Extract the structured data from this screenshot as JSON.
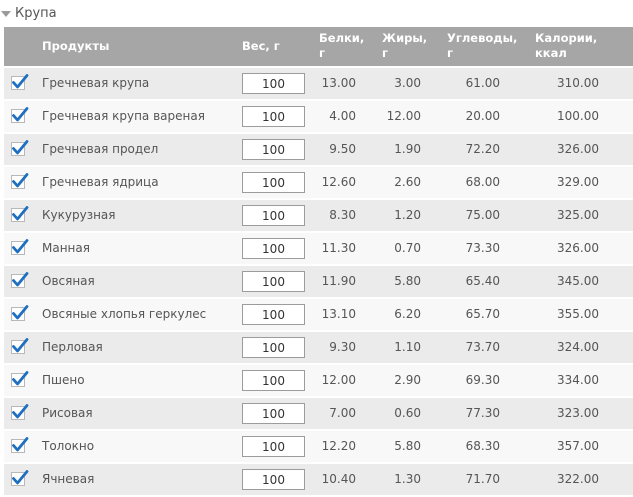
{
  "section": {
    "title": "Крупа",
    "icon": "collapse-triangle-icon"
  },
  "columns": {
    "product": "Продукты",
    "weight": "Вес, г",
    "protein_line1": "Белки,",
    "protein_line2": "г",
    "fat_line1": "Жиры,",
    "fat_line2": "г",
    "carbs_line1": "Углеводы,",
    "carbs_line2": "г",
    "calories_line1": "Калории,",
    "calories_line2": "ккал"
  },
  "colors": {
    "header_bg": "#a6a6a6",
    "row_odd": "#ebebeb",
    "row_even": "#f8f8f8",
    "checkmark": "#1e6fc0"
  },
  "rows": [
    {
      "name": "Гречневая крупа",
      "checked": true,
      "weight": "100",
      "protein": "13.00",
      "fat": "3.00",
      "carbs": "61.00",
      "calories": "310.00"
    },
    {
      "name": "Гречневая крупа вареная",
      "checked": true,
      "weight": "100",
      "protein": "4.00",
      "fat": "12.00",
      "carbs": "20.00",
      "calories": "100.00"
    },
    {
      "name": "Гречневая продел",
      "checked": true,
      "weight": "100",
      "protein": "9.50",
      "fat": "1.90",
      "carbs": "72.20",
      "calories": "326.00"
    },
    {
      "name": "Гречневая ядрица",
      "checked": true,
      "weight": "100",
      "protein": "12.60",
      "fat": "2.60",
      "carbs": "68.00",
      "calories": "329.00"
    },
    {
      "name": "Кукурузная",
      "checked": true,
      "weight": "100",
      "protein": "8.30",
      "fat": "1.20",
      "carbs": "75.00",
      "calories": "325.00"
    },
    {
      "name": "Манная",
      "checked": true,
      "weight": "100",
      "protein": "11.30",
      "fat": "0.70",
      "carbs": "73.30",
      "calories": "326.00"
    },
    {
      "name": "Овсяная",
      "checked": true,
      "weight": "100",
      "protein": "11.90",
      "fat": "5.80",
      "carbs": "65.40",
      "calories": "345.00"
    },
    {
      "name": "Овсяные хлопья геркулес",
      "checked": true,
      "weight": "100",
      "protein": "13.10",
      "fat": "6.20",
      "carbs": "65.70",
      "calories": "355.00"
    },
    {
      "name": "Перловая",
      "checked": true,
      "weight": "100",
      "protein": "9.30",
      "fat": "1.10",
      "carbs": "73.70",
      "calories": "324.00"
    },
    {
      "name": "Пшено",
      "checked": true,
      "weight": "100",
      "protein": "12.00",
      "fat": "2.90",
      "carbs": "69.30",
      "calories": "334.00"
    },
    {
      "name": "Рисовая",
      "checked": true,
      "weight": "100",
      "protein": "7.00",
      "fat": "0.60",
      "carbs": "77.30",
      "calories": "323.00"
    },
    {
      "name": "Толокно",
      "checked": true,
      "weight": "100",
      "protein": "12.20",
      "fat": "5.80",
      "carbs": "68.30",
      "calories": "357.00"
    },
    {
      "name": "Ячневая",
      "checked": true,
      "weight": "100",
      "protein": "10.40",
      "fat": "1.30",
      "carbs": "71.70",
      "calories": "322.00"
    }
  ]
}
